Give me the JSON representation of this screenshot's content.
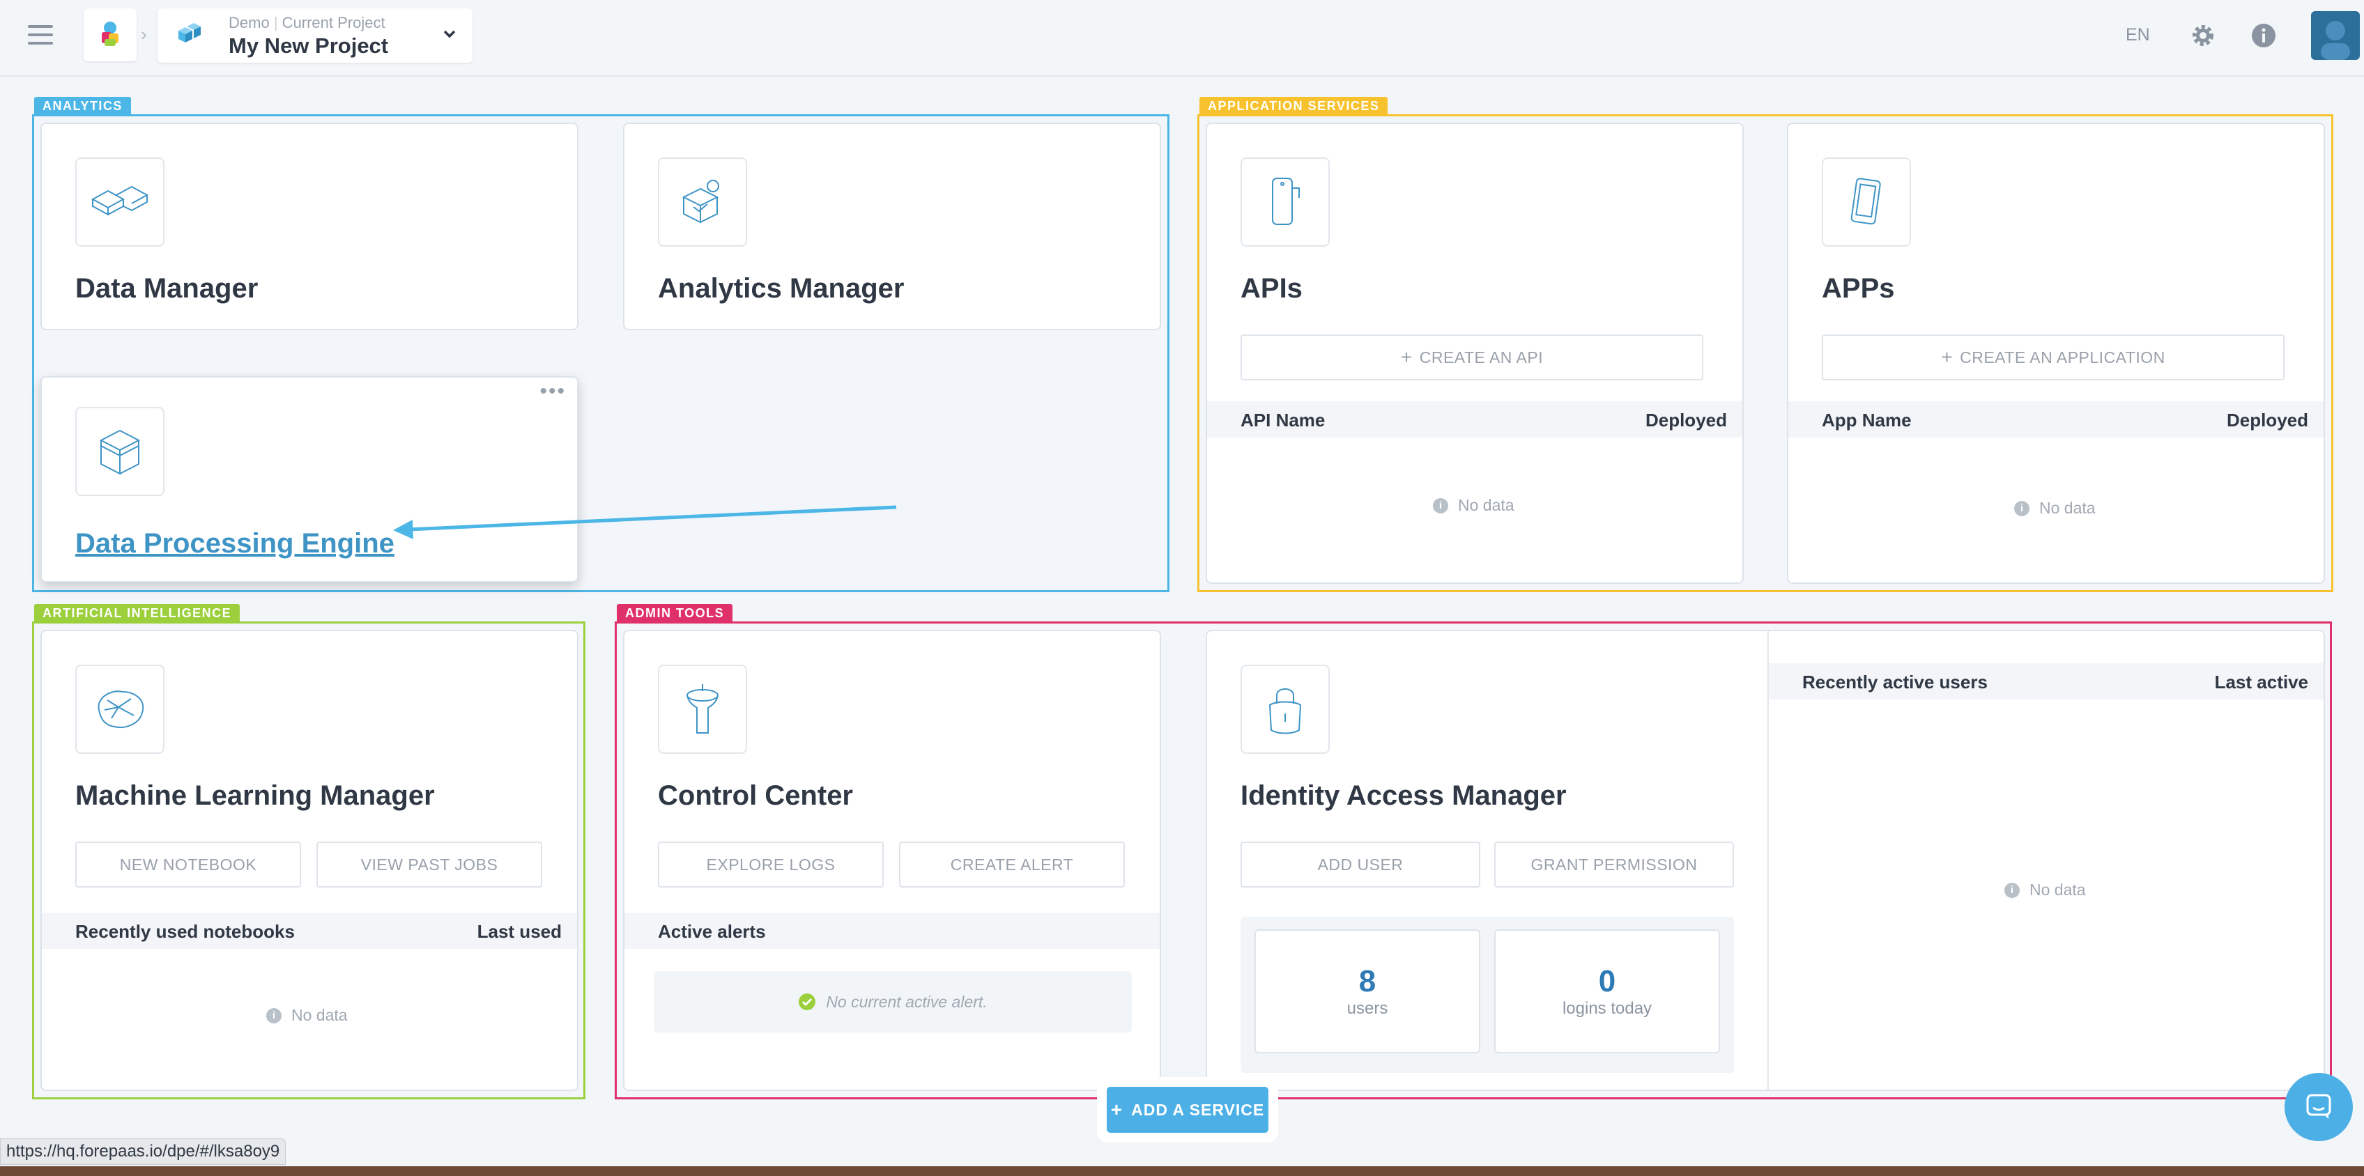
{
  "header": {
    "org": "Demo",
    "current_label": "Current Project",
    "project_name": "My New Project",
    "language": "EN"
  },
  "sections": {
    "analytics": "ANALYTICS",
    "application_services": "APPLICATION SERVICES",
    "artificial_intelligence": "ARTIFICIAL INTELLIGENCE",
    "admin_tools": "ADMIN TOOLS"
  },
  "colors": {
    "analytics": "#4cb6e6",
    "application_services": "#f7c22d",
    "artificial_intelligence": "#9ccf3c",
    "admin_tools": "#e0306a",
    "accent": "#4cb0e6"
  },
  "cards": {
    "data_manager": {
      "title": "Data Manager",
      "icon": "data-manager-icon"
    },
    "analytics_manager": {
      "title": "Analytics Manager",
      "icon": "analytics-manager-icon"
    },
    "data_processing_engine": {
      "title": "Data Processing Engine",
      "icon": "cube-icon"
    },
    "apis": {
      "title": "APIs",
      "create_label": "CREATE AN API",
      "col_name": "API Name",
      "col_status": "Deployed",
      "empty": "No data"
    },
    "apps": {
      "title": "APPs",
      "create_label": "CREATE AN APPLICATION",
      "col_name": "App Name",
      "col_status": "Deployed",
      "empty": "No data"
    },
    "ml_manager": {
      "title": "Machine Learning Manager",
      "btn_new": "NEW NOTEBOOK",
      "btn_past": "VIEW PAST JOBS",
      "col_name": "Recently used notebooks",
      "col_status": "Last used",
      "empty": "No data"
    },
    "control_center": {
      "title": "Control Center",
      "btn_logs": "EXPLORE LOGS",
      "btn_alert": "CREATE ALERT",
      "alerts_header": "Active alerts",
      "no_alert": "No current active alert."
    },
    "iam": {
      "title": "Identity Access Manager",
      "btn_add_user": "ADD USER",
      "btn_grant": "GRANT PERMISSION",
      "users_count": "8",
      "users_label": "users",
      "logins_count": "0",
      "logins_label": "logins today",
      "col_users": "Recently active users",
      "col_last": "Last active",
      "empty": "No data"
    }
  },
  "add_service": "ADD A SERVICE",
  "status_url": "https://hq.forepaas.io/dpe/#/lksa8oy9"
}
